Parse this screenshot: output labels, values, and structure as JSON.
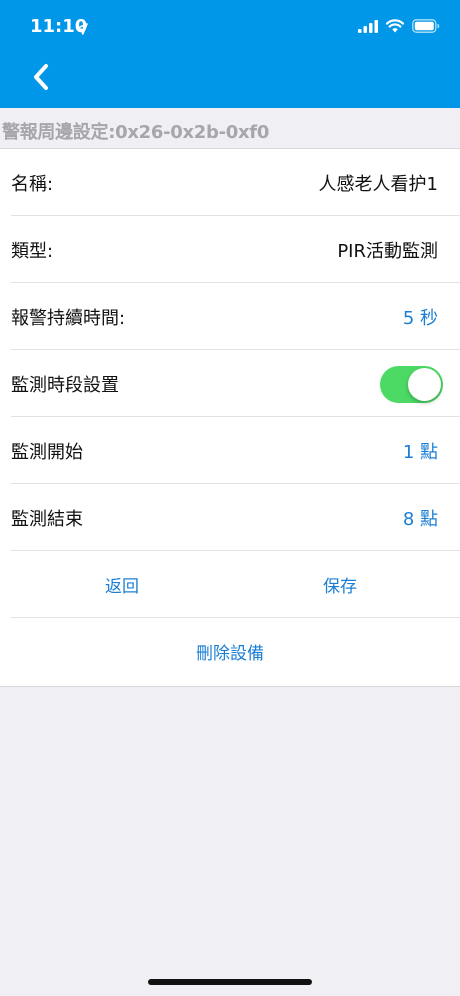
{
  "status_bar": {
    "time": "11:10"
  },
  "header": {
    "back_icon": "chevron-left-icon"
  },
  "section": {
    "title": "警報周邊設定:0x26-0x2b-0xf0"
  },
  "fields": [
    {
      "label": "名稱:",
      "value": "人感老人看护1"
    },
    {
      "label": "類型:",
      "value": "PIR活動監測"
    },
    {
      "label": "報警持續時間:",
      "value": "5 秒"
    },
    {
      "label": "監測時段設置",
      "toggle_on": true
    },
    {
      "label": "監測開始",
      "value": "1 點"
    },
    {
      "label": "監測結束",
      "value": "8 點"
    }
  ],
  "actions": {
    "back_label": "返回",
    "save_label": "保存",
    "delete_label": "刪除設備"
  },
  "colors": {
    "header_bg": "#0097e9",
    "accent_blue": "#1a7fd4",
    "toggle_on": "#4cd964",
    "page_bg": "#efeff4"
  }
}
